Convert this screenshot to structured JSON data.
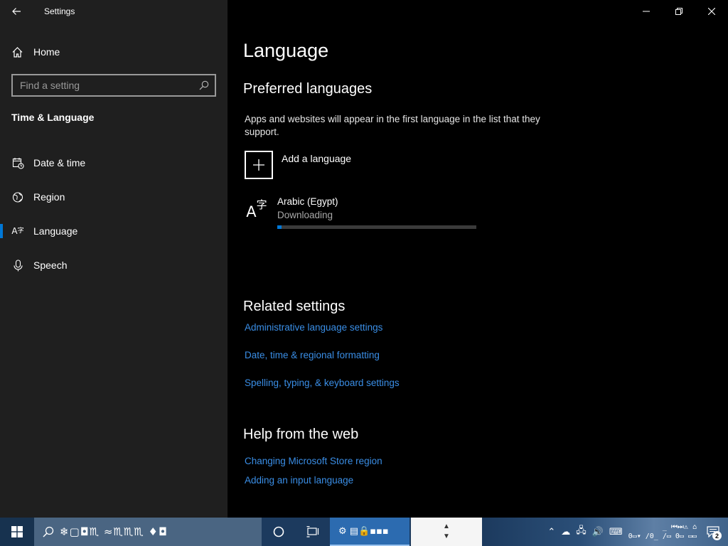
{
  "window": {
    "title": "Settings",
    "controls": [
      "minimize",
      "restore",
      "close"
    ]
  },
  "sidebar": {
    "home_label": "Home",
    "search_placeholder": "Find a setting",
    "section_title": "Time & Language",
    "items": [
      {
        "label": "Date & time",
        "icon": "date-time-icon",
        "active": false
      },
      {
        "label": "Region",
        "icon": "region-globe-icon",
        "active": false
      },
      {
        "label": "Language",
        "icon": "language-icon",
        "active": true
      },
      {
        "label": "Speech",
        "icon": "microphone-icon",
        "active": false
      }
    ]
  },
  "main": {
    "page_title": "Language",
    "preferred": {
      "heading": "Preferred languages",
      "description": "Apps and websites will appear in the first language in the list that they support.",
      "add_label": "Add a language",
      "languages": [
        {
          "name": "Arabic (Egypt)",
          "status": "Downloading",
          "progress": 0.02
        }
      ]
    },
    "related": {
      "heading": "Related settings",
      "links": [
        "Administrative language settings",
        "Date, time & regional formatting",
        "Spelling, typing, & keyboard settings"
      ]
    },
    "help": {
      "heading": "Help from the web",
      "links": [
        "Changing Microsoft Store region",
        "Adding an input language"
      ]
    },
    "accent_color": "#0078d7",
    "link_color": "#3a8ee6"
  },
  "taskbar": {
    "search_text": "❄▢◘♏ ≈♏♏♏ ♦◘",
    "settings_text": "⚙ ▤🔒▪▪▪",
    "notification_count": "2",
    "clock_line1": "_ ⏮⏭⚠ ⌂ ",
    "clock_line2": "0▭▾ /0_ /▭ 0▭ ▭▭",
    "colors": {
      "bar": "#1c3a5e",
      "search": "#4a6582",
      "active_app": "#2c6bb0"
    }
  }
}
